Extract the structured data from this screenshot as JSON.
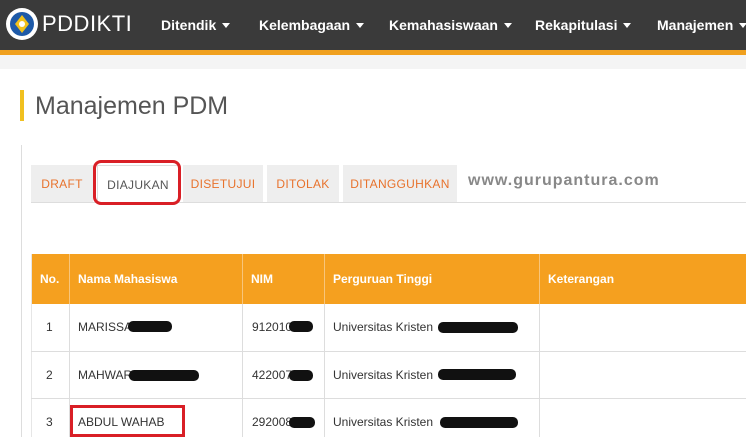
{
  "app": {
    "logo_text": "PDDIKTI"
  },
  "nav": {
    "items": [
      {
        "label": "Ditendik"
      },
      {
        "label": "Kelembagaan"
      },
      {
        "label": "Kemahasiswaan"
      },
      {
        "label": "Rekapitulasi"
      },
      {
        "label": "Manajemen"
      }
    ]
  },
  "page": {
    "title": "Manajemen PDM"
  },
  "tabs": [
    {
      "label": "DRAFT"
    },
    {
      "label": "DIAJUKAN",
      "active": true
    },
    {
      "label": "DISETUJUI"
    },
    {
      "label": "DITOLAK"
    },
    {
      "label": "DITANGGUHKAN"
    }
  ],
  "watermark": "www.gurupantura.com",
  "table": {
    "columns": [
      "No.",
      "Nama Mahasiswa",
      "NIM",
      "Perguruan Tinggi",
      "Keterangan"
    ],
    "rows": [
      {
        "no": "1",
        "nama": "MARISSA",
        "nim": "912010",
        "pt": "Universitas Kristen",
        "ket": ""
      },
      {
        "no": "2",
        "nama": "MAHWAR",
        "nim": "422007",
        "pt": "Universitas Kristen",
        "ket": ""
      },
      {
        "no": "3",
        "nama": "ABDUL WAHAB",
        "nim": "292008",
        "pt": "Universitas Kristen",
        "ket": ""
      }
    ]
  },
  "colors": {
    "topbar": "#3a3a3a",
    "accent": "#f5a01f",
    "tab_text": "#e8722c",
    "highlight": "#d91f26"
  }
}
